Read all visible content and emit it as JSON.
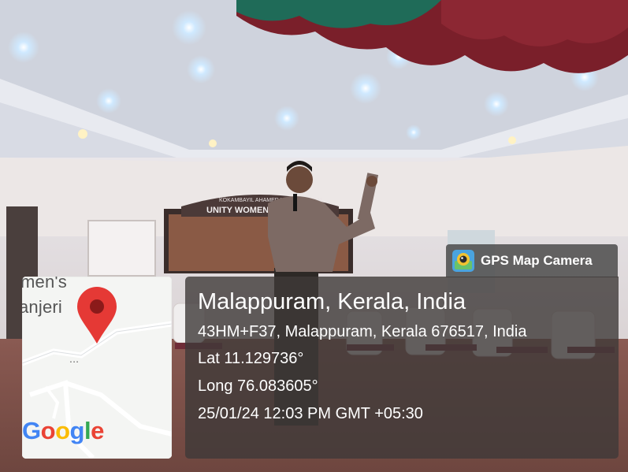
{
  "photo": {
    "subject": "man speaking into a microphone in a hall"
  },
  "banner": {
    "line1": "KOKAMBAYIL AHAMED HAJI MEMORIAL",
    "line2": "UNITY WOMEN'S C"
  },
  "map": {
    "label_1": "men's",
    "label_2": "anjeri",
    "ellipsis": "...",
    "google_letters": [
      "G",
      "o",
      "o",
      "g",
      "l",
      "e"
    ],
    "google_colors": [
      "#4285F4",
      "#EA4335",
      "#FBBC05",
      "#4285F4",
      "#34A853",
      "#EA4335"
    ],
    "pin_color": "#E53935"
  },
  "badge": {
    "icon": "camera-lens-icon",
    "label": "GPS Map Camera"
  },
  "info": {
    "place": "Malappuram, Kerala, India",
    "address": "43HM+F37, Malappuram, Kerala 676517, India",
    "lat": "Lat 11.129736°",
    "long": "Long 76.083605°",
    "datetime": "25/01/24 12:03 PM GMT +05:30"
  }
}
